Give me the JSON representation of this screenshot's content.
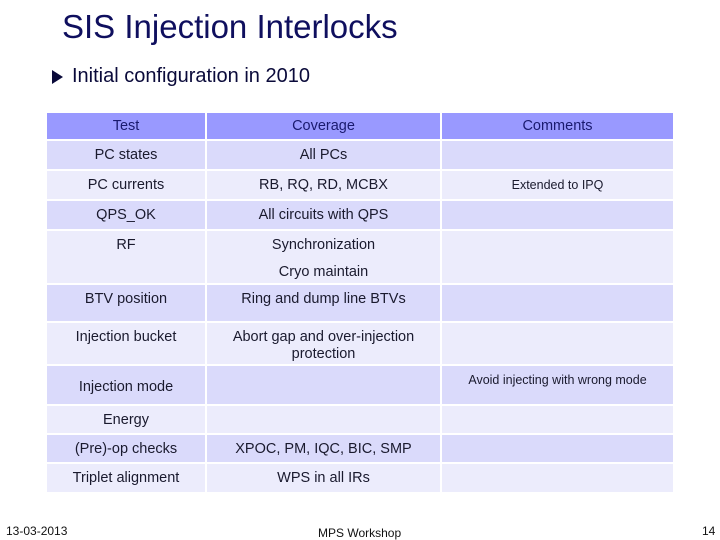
{
  "slide": {
    "title": "SIS Injection Interlocks",
    "bullet": "Initial configuration in 2010",
    "bullet_icon": "arrow-bullet-icon"
  },
  "table": {
    "headers": [
      "Test",
      "Coverage",
      "Comments"
    ],
    "rows": [
      {
        "test": "PC states",
        "coverage": "All PCs",
        "comments": ""
      },
      {
        "test": "PC currents",
        "coverage": "RB, RQ, RD, MCBX",
        "comments": "Extended to IPQ"
      },
      {
        "test": "QPS_OK",
        "coverage": "All circuits with QPS",
        "comments": ""
      },
      {
        "test": "RF",
        "coverage": "Synchronization",
        "coverage2": "Cryo maintain",
        "comments": ""
      },
      {
        "test": "BTV position",
        "coverage": "Ring and dump line BTVs",
        "comments": ""
      },
      {
        "test": "Injection bucket",
        "coverage": "Abort gap and over-injection protection",
        "comments": ""
      },
      {
        "test": "Injection mode",
        "coverage": "",
        "comments": "Avoid injecting with wrong mode"
      },
      {
        "test": "Energy",
        "coverage": "",
        "comments": ""
      },
      {
        "test": "(Pre)-op checks",
        "coverage": "XPOC, PM, IQC, BIC, SMP",
        "comments": ""
      },
      {
        "test": "Triplet alignment",
        "coverage": "WPS in all IRs",
        "comments": ""
      }
    ],
    "colors": {
      "header": "#9999ff",
      "row_odd": "#dadafb",
      "row_even": "#ececfc"
    }
  },
  "footer": {
    "date": "13-03-2013",
    "event": "MPS Workshop",
    "page": "14"
  }
}
